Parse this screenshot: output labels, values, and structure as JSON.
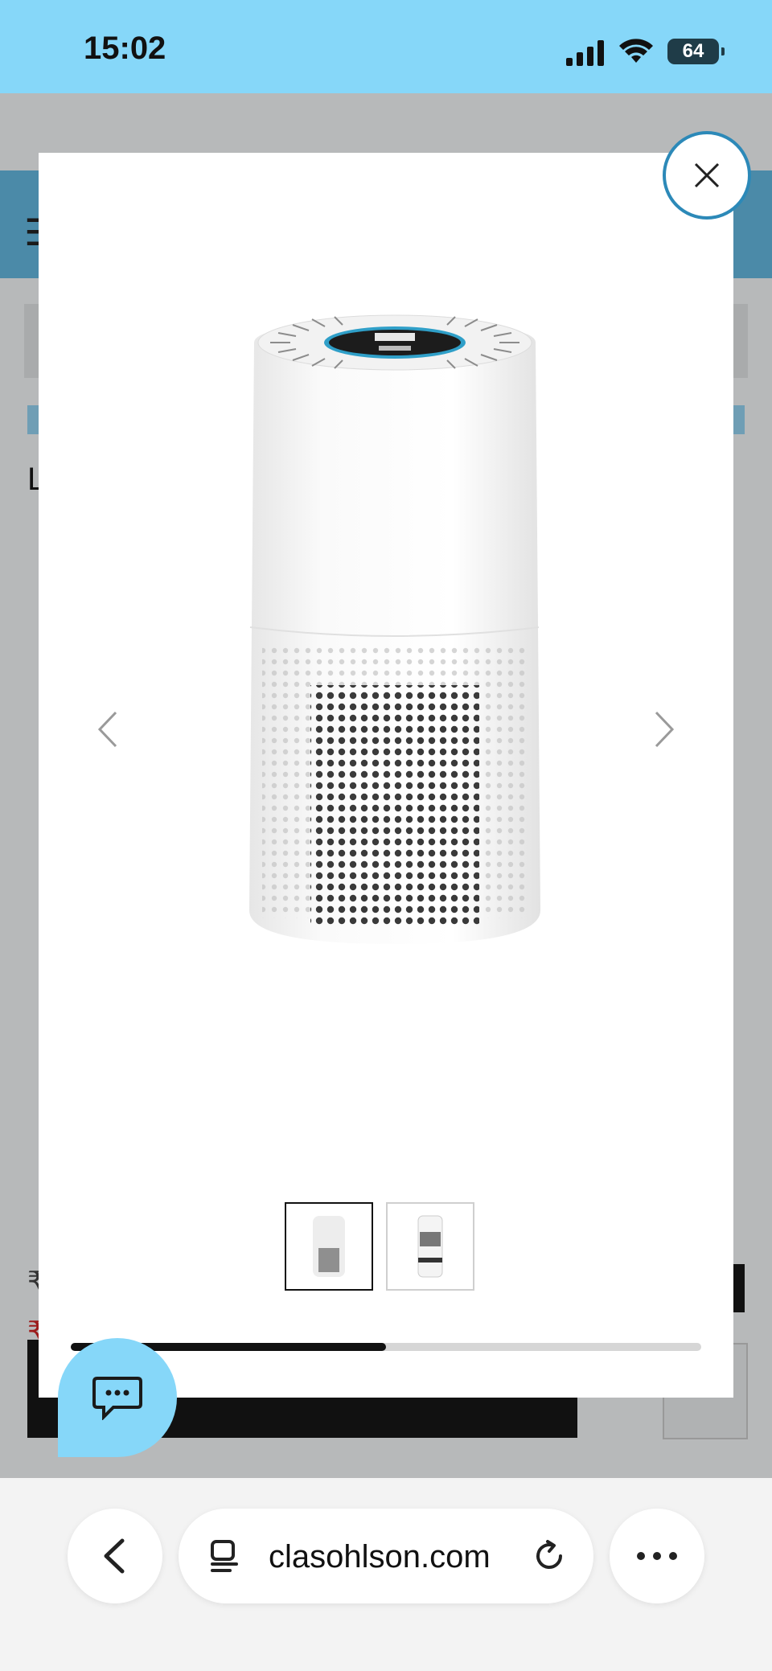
{
  "status_bar": {
    "time": "15:02",
    "battery_level": "64",
    "signal_icon": "signal-bars-icon",
    "wifi_icon": "wifi-icon",
    "background": "#86d7f9"
  },
  "background_page": {
    "menu_glyph": "☰",
    "partial_letter": "L",
    "partial_old_price": "₹",
    "partial_new_price": "₹"
  },
  "modal": {
    "close_icon": "close-icon",
    "prev_icon": "chevron-left-icon",
    "next_icon": "chevron-right-icon",
    "image_subject": "air purifier",
    "thumbnails_count": 2,
    "selected_thumbnail": 1,
    "carousel_progress": 0.5,
    "accent": "#2c89b8"
  },
  "chat": {
    "icon": "chat-bubble-icon",
    "background": "#86d7f9"
  },
  "browser": {
    "url": "clasohlson.com",
    "back_icon": "chevron-left-icon",
    "tabs_icon": "tab-overview-icon",
    "reload_icon": "reload-icon",
    "more_icon": "more-dots-icon"
  }
}
